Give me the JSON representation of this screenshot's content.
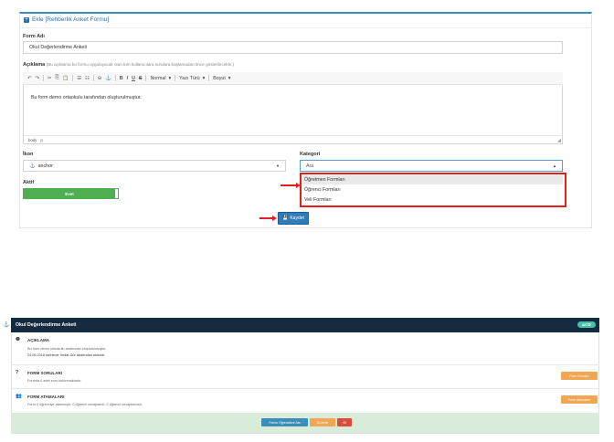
{
  "form_card": {
    "title": "Ekle [Rehberlik Anket Formu]",
    "form_name_label": "Form Adı",
    "form_name_value": "Okul Değerlendirme Anketi",
    "description_label": "Açıklama",
    "description_hint": "(Bu açıklama bu formu uygulayacak olan tüm kullanıcılara sorulara başlamadan önce gösterilecektir.)",
    "editor": {
      "toolbar": {
        "undo": "↶",
        "redo": "↷",
        "cut": "✂",
        "copy": "⎘",
        "paste": "📋",
        "ol": "☰",
        "ul": "☷",
        "hr": "⊖",
        "anchor": "⚓",
        "bold": "B",
        "italic": "I",
        "underline": "U",
        "strike": "S",
        "format": "Normal",
        "font": "Yazı Türü",
        "size": "Boyut"
      },
      "content": "Bu form demo ortaokulu tarafından oluşturulmuştur.",
      "status_path": [
        "body",
        "p"
      ]
    },
    "icon_label": "İkon",
    "icon_value": "anchor",
    "category_label": "Kategori",
    "category_value": "Ara",
    "active_label": "Aktif",
    "active_value": "Evet",
    "category_options": [
      "Öğretmen Formları",
      "Öğrenci Formları",
      "Veli Formları"
    ],
    "save_label": "Kaydet"
  },
  "preview_panel": {
    "title": "Okul Değerlendirme Anketi",
    "badge": "AKTİF",
    "sections": [
      {
        "icon": "info-icon",
        "title": "AÇIKLAMA",
        "lines": [
          "Bu form demo ortaokulu tarafından oluşturulmuştur.",
          "24.05.2018 tarihinde Vedat Gür tarafından eklendi."
        ],
        "button": ""
      },
      {
        "icon": "question-icon",
        "title": "FORM SORULARI",
        "lines": [
          "Formda 0 adet soru bulunmaktadır."
        ],
        "button": "Form Soruları"
      },
      {
        "icon": "users-icon",
        "title": "FORM ATAMALARI",
        "lines": [
          "Form 0 öğrenciye atanmıştır. 0 öğrenci cevaplandı. 0 öğrenci cevaplamadı."
        ],
        "button": "Form Atamaları"
      }
    ],
    "footer_buttons": [
      {
        "label": "Formu Öğrencilere Ata",
        "color": "#3c8dbc"
      },
      {
        "label": "Düzenle",
        "color": "#f2a654"
      },
      {
        "label": "Sil",
        "color": "#dd4b39"
      }
    ]
  },
  "colors": {
    "accent": "#3c8dbc",
    "highlight_red": "#e01f1f",
    "active_green": "#4fae4f",
    "panel_header": "#152b40"
  }
}
